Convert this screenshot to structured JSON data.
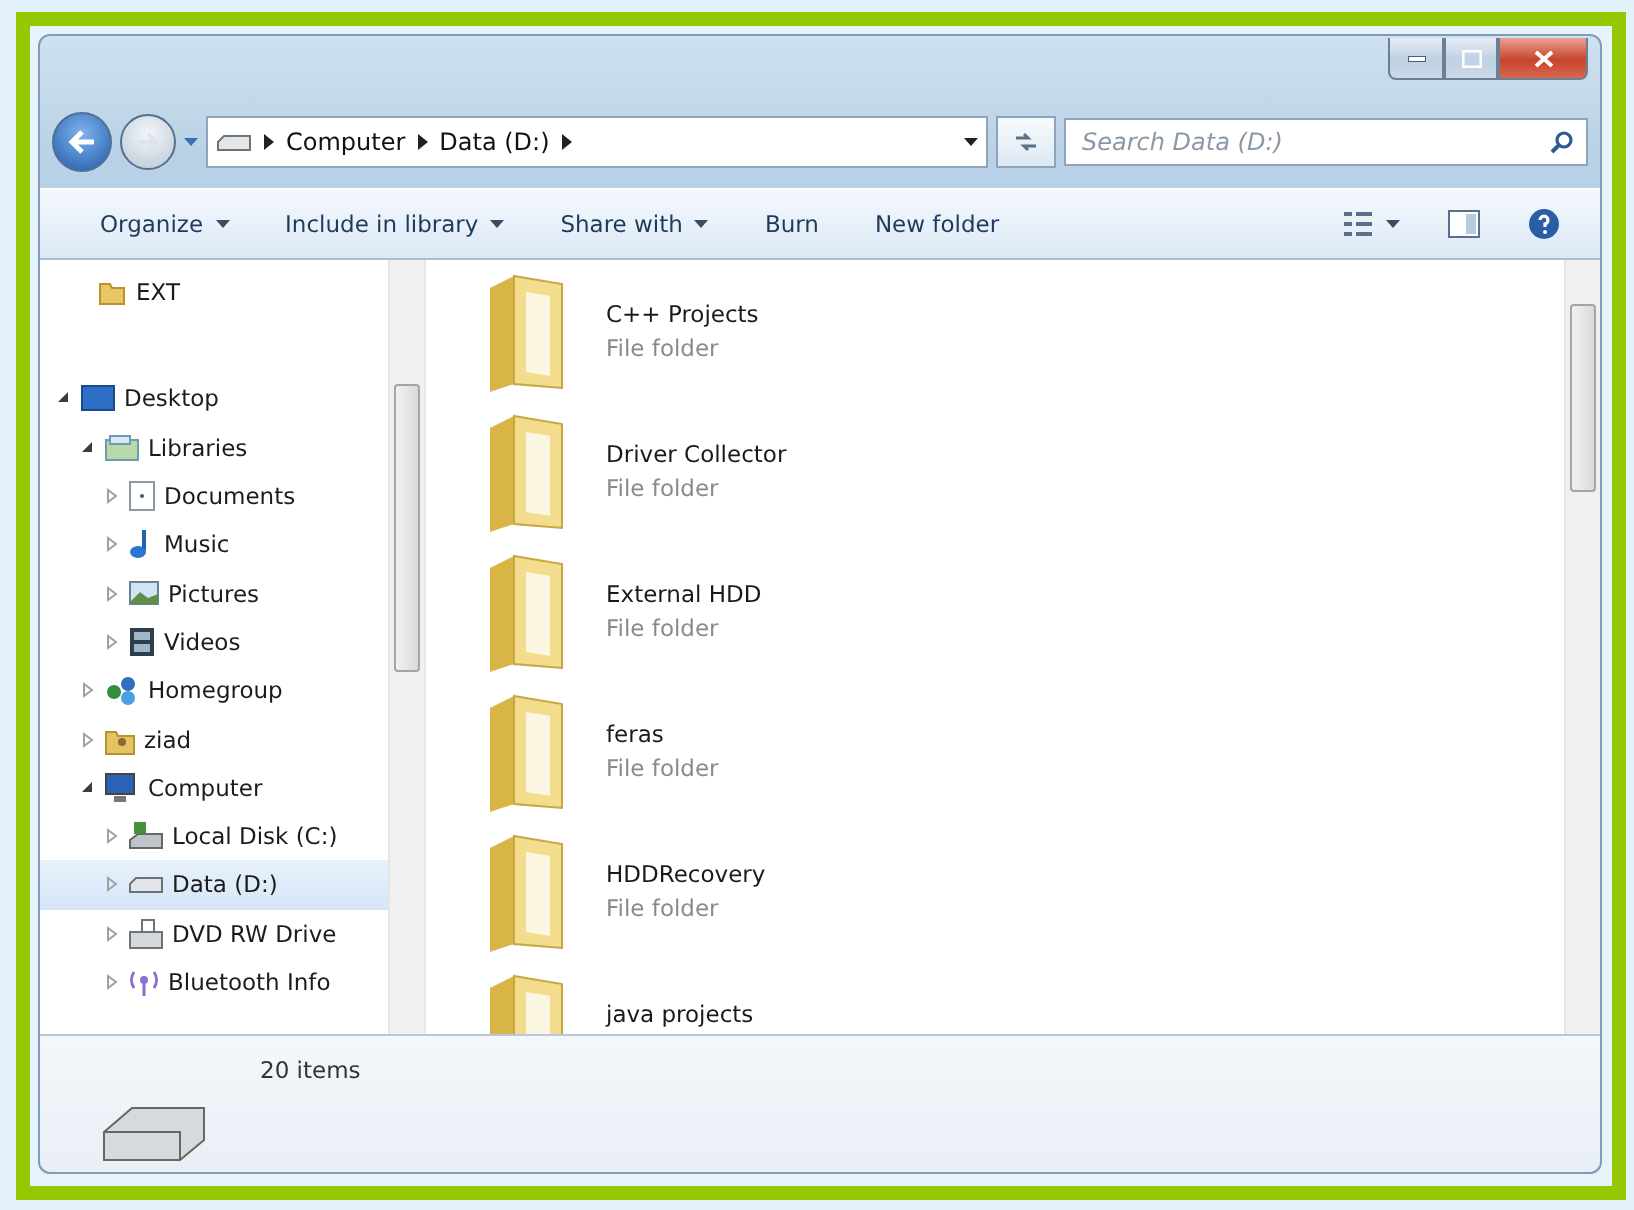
{
  "address_bar": {
    "crumbs": [
      "Computer",
      "Data (D:)"
    ]
  },
  "search": {
    "placeholder": "Search Data (D:)"
  },
  "toolbar": {
    "buttons": [
      {
        "label": "Organize",
        "dropdown": true
      },
      {
        "label": "Include in library",
        "dropdown": true
      },
      {
        "label": "Share with",
        "dropdown": true
      },
      {
        "label": "Burn",
        "dropdown": false
      },
      {
        "label": "New folder",
        "dropdown": false
      }
    ]
  },
  "nav_pane": {
    "pinned_item": {
      "label": "EXT",
      "kind": "folder"
    },
    "tree": [
      {
        "label": "Desktop",
        "kind": "desktop",
        "expanded": true,
        "selected": false,
        "children": [
          {
            "label": "Libraries",
            "kind": "library",
            "expanded": true,
            "selected": false,
            "children": [
              {
                "label": "Documents",
                "kind": "document",
                "expanded": false,
                "selected": false
              },
              {
                "label": "Music",
                "kind": "music",
                "expanded": false,
                "selected": false
              },
              {
                "label": "Pictures",
                "kind": "pictures",
                "expanded": false,
                "selected": false
              },
              {
                "label": "Videos",
                "kind": "videos",
                "expanded": false,
                "selected": false
              }
            ]
          },
          {
            "label": "Homegroup",
            "kind": "homegroup",
            "expanded": false,
            "selected": false
          },
          {
            "label": "ziad",
            "kind": "user",
            "expanded": false,
            "selected": false
          },
          {
            "label": "Computer",
            "kind": "computer",
            "expanded": true,
            "selected": false,
            "children": [
              {
                "label": "Local Disk (C:)",
                "kind": "system-disk",
                "expanded": false,
                "selected": false
              },
              {
                "label": "Data (D:)",
                "kind": "drive",
                "expanded": false,
                "selected": true
              },
              {
                "label": "DVD RW Drive",
                "kind": "dvd",
                "expanded": false,
                "selected": false
              },
              {
                "label": "Bluetooth Info",
                "kind": "bluetooth",
                "expanded": false,
                "selected": false
              }
            ]
          }
        ]
      }
    ]
  },
  "files": [
    {
      "name": "C++ Projects",
      "type": "File folder"
    },
    {
      "name": "Driver Collector",
      "type": "File folder"
    },
    {
      "name": "External HDD",
      "type": "File folder"
    },
    {
      "name": "feras",
      "type": "File folder"
    },
    {
      "name": "HDDRecovery",
      "type": "File folder"
    },
    {
      "name": "java projects"
    }
  ],
  "status_bar": {
    "count": "20 items"
  }
}
